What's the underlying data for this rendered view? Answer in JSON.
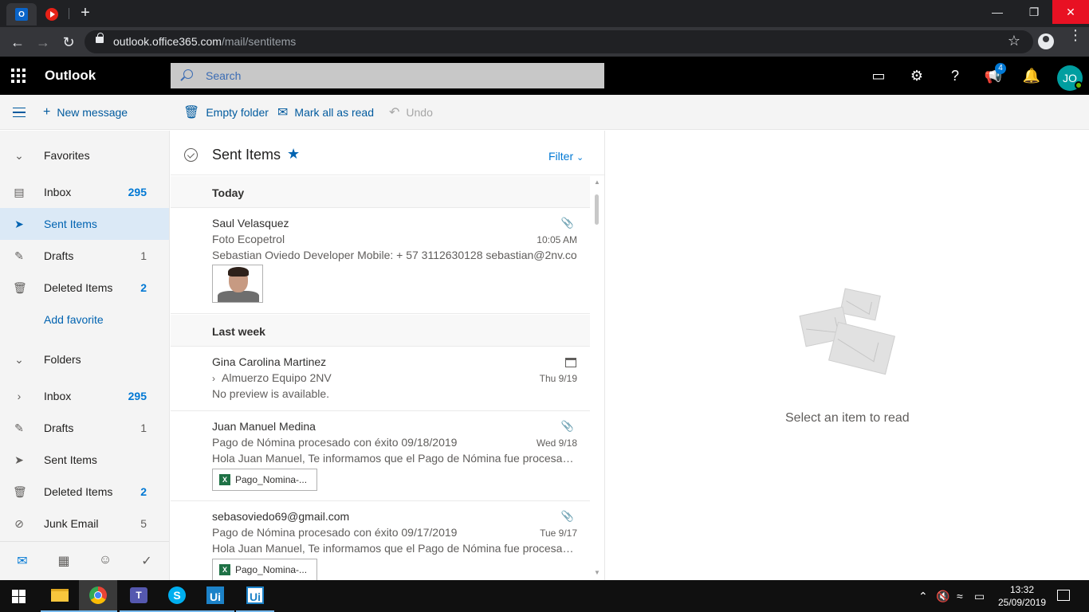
{
  "browser": {
    "url_host": "outlook.office365.com",
    "url_path": "/mail/sentitems",
    "tab_icons": [
      "outlook-icon",
      "youtube-music-icon"
    ],
    "new_tab_label": "+"
  },
  "app": {
    "brand": "Outlook",
    "search_placeholder": "Search",
    "notification_badge": "4",
    "avatar_initials": "JO"
  },
  "toolbar": {
    "new_message": "New message",
    "empty_folder": "Empty folder",
    "mark_all_read": "Mark all as read",
    "undo": "Undo"
  },
  "favorites": {
    "header": "Favorites",
    "items": [
      {
        "label": "Inbox",
        "count": "295"
      },
      {
        "label": "Sent Items",
        "count": ""
      },
      {
        "label": "Drafts",
        "count": "1"
      },
      {
        "label": "Deleted Items",
        "count": "2"
      }
    ],
    "add_favorite": "Add favorite"
  },
  "folders": {
    "header": "Folders",
    "items": [
      {
        "label": "Inbox",
        "count": "295"
      },
      {
        "label": "Drafts",
        "count": "1"
      },
      {
        "label": "Sent Items",
        "count": ""
      },
      {
        "label": "Deleted Items",
        "count": "2"
      },
      {
        "label": "Junk Email",
        "count": "5"
      }
    ]
  },
  "message_list": {
    "title": "Sent Items",
    "filter": "Filter",
    "groups": [
      {
        "label": "Today",
        "messages": [
          {
            "from": "Saul Velasquez",
            "subject": "Foto Ecopetrol",
            "preview": "Sebastian Oviedo Developer Mobile: + 57 3112630128 sebastian@2nv.co",
            "date": "10:05 AM"
          }
        ]
      },
      {
        "label": "Last week",
        "messages": [
          {
            "from": "Gina Carolina Martinez",
            "subject": "Almuerzo Equipo 2NV",
            "preview": "No preview is available.",
            "date": "Thu 9/19"
          },
          {
            "from": "Juan Manuel Medina",
            "subject": "Pago de Nómina procesado con éxito 09/18/2019",
            "preview": "Hola Juan Manuel, Te informamos que el Pago de Nómina fue procesado con éxito",
            "date": "Wed 9/18",
            "attachment": "Pago_Nomina-..."
          },
          {
            "from": "sebasoviedo69@gmail.com",
            "subject": "Pago de Nómina procesado con éxito 09/17/2019",
            "preview": "Hola Juan Manuel, Te informamos que el Pago de Nómina fue procesado con éxito",
            "date": "Tue 9/17",
            "attachment": "Pago_Nomina-..."
          }
        ]
      }
    ]
  },
  "reading_pane": {
    "empty_text": "Select an item to read"
  },
  "taskbar": {
    "time": "13:32",
    "date": "25/09/2019",
    "apps": [
      "file-explorer",
      "chrome",
      "teams",
      "skype",
      "uipath-studio",
      "uipath-robot"
    ]
  }
}
